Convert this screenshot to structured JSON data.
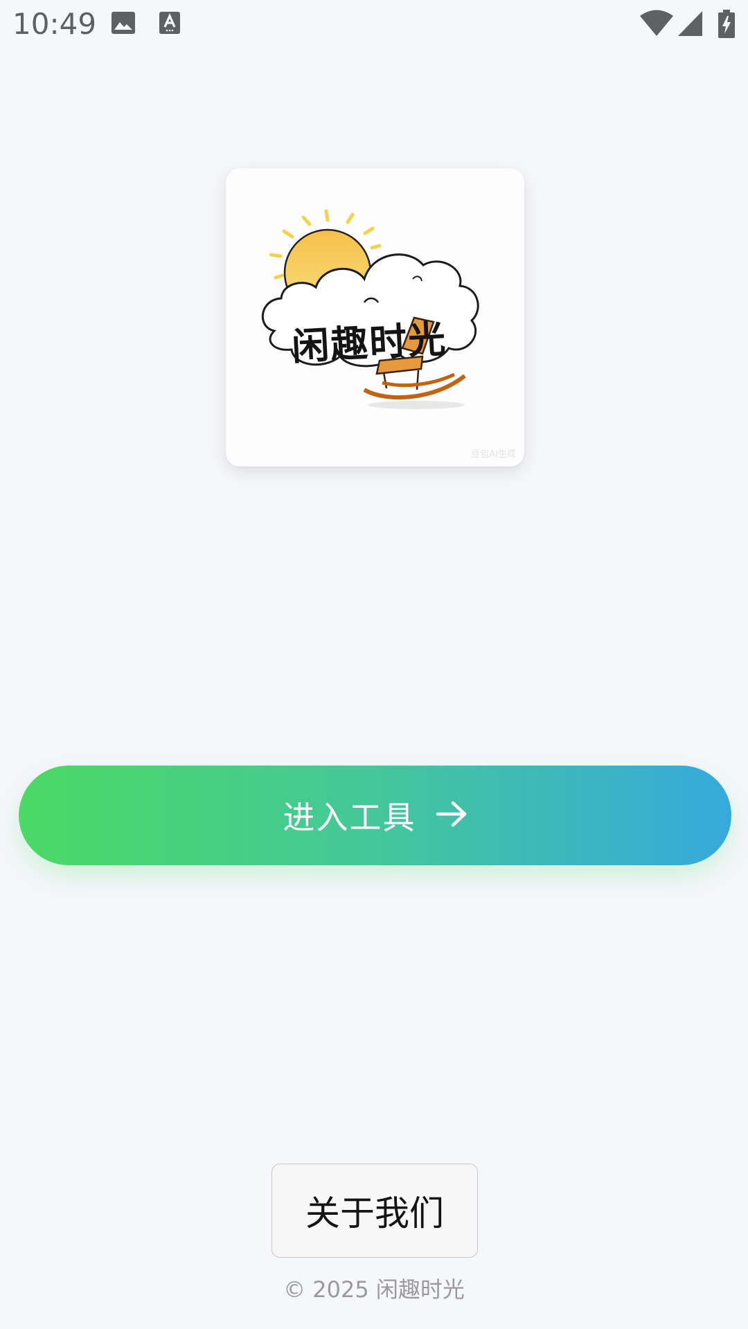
{
  "status_bar": {
    "time": "10:49",
    "icons": [
      "image-icon",
      "keyboard-a-icon",
      "wifi-icon",
      "cell-signal-icon",
      "battery-charging-icon"
    ]
  },
  "logo": {
    "title": "闲趣时光",
    "watermark": "豆包AI生成",
    "icons": [
      "sun-icon",
      "cloud-icon",
      "rocking-chair-icon"
    ]
  },
  "primary_button": {
    "label": "进入工具",
    "icon": "arrow-right-icon",
    "gradient": [
      "#4cd964",
      "#36a9dc"
    ]
  },
  "about_button": {
    "label": "关于我们"
  },
  "footer": {
    "copyright": "© 2025 闲趣时光"
  },
  "colors": {
    "background": "#f5f7fb",
    "text_dark": "#141414",
    "text_muted": "#9a9a9a"
  }
}
